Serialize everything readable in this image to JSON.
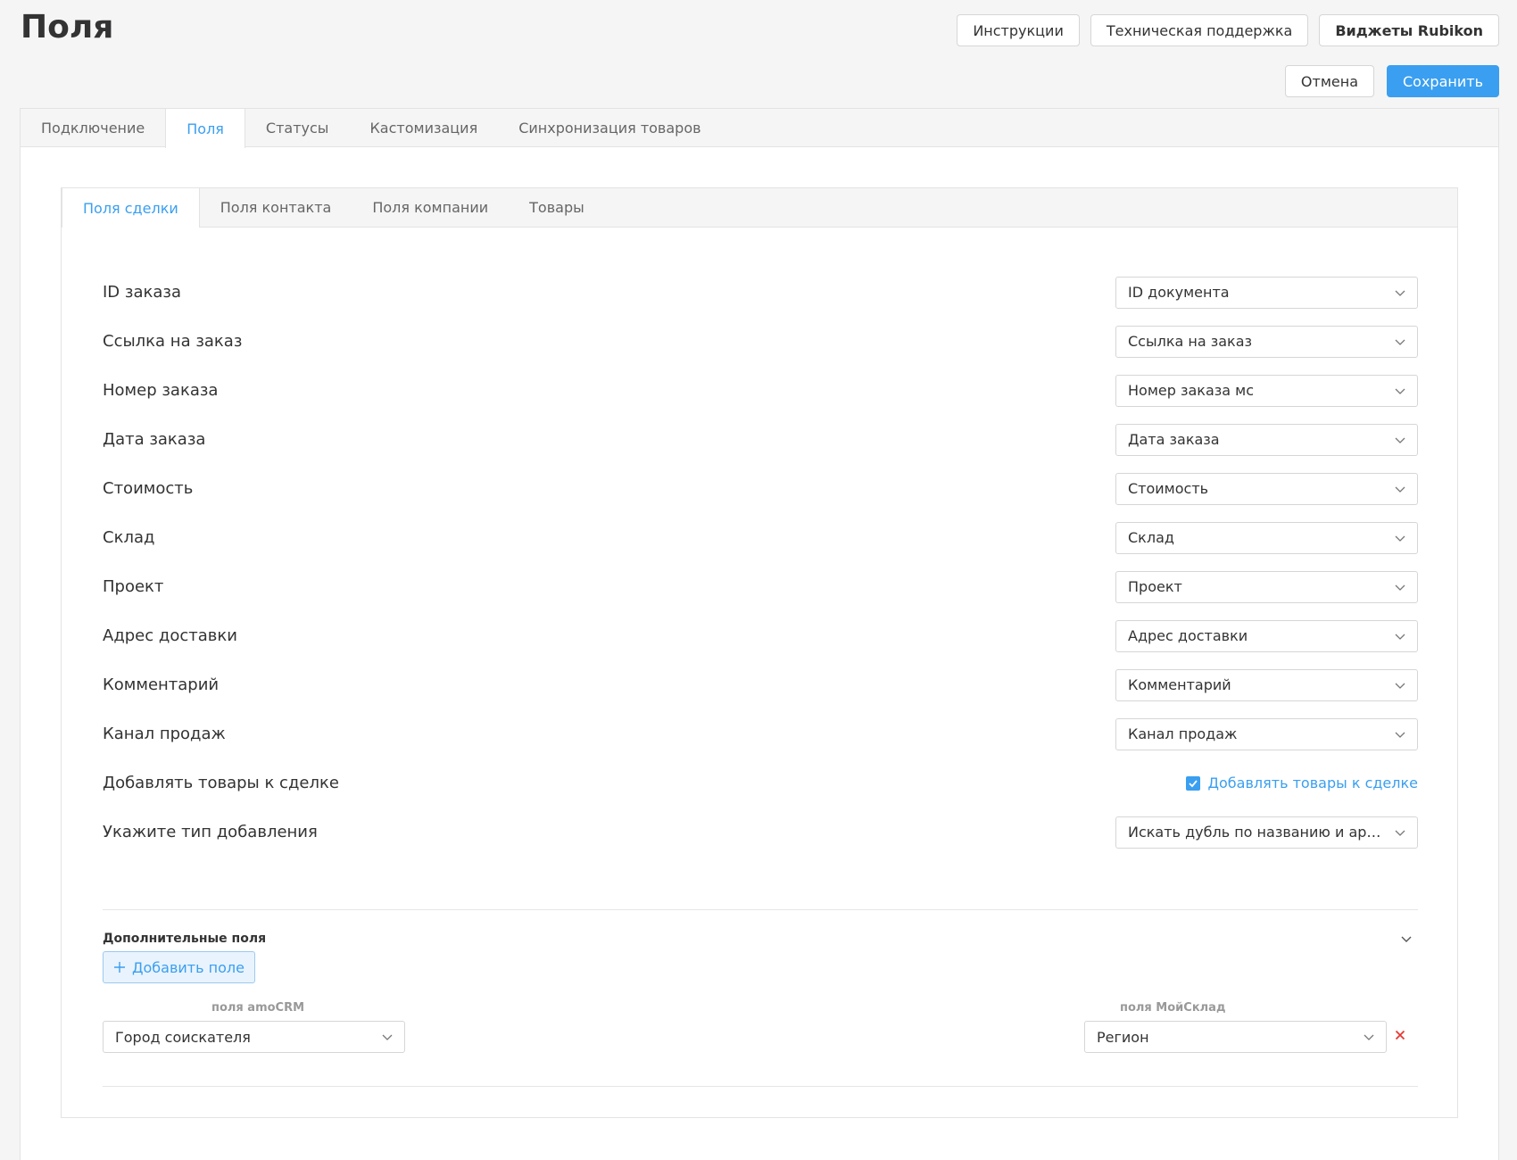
{
  "header": {
    "title": "Поля",
    "instructions_label": "Инструкции",
    "support_label": "Техническая поддержка",
    "widgets_label": "Виджеты Rubikon",
    "cancel_label": "Отмена",
    "save_label": "Сохранить"
  },
  "main_tabs": [
    {
      "label": "Подключение",
      "active": false
    },
    {
      "label": "Поля",
      "active": true
    },
    {
      "label": "Статусы",
      "active": false
    },
    {
      "label": "Кастомизация",
      "active": false
    },
    {
      "label": "Синхронизация товаров",
      "active": false
    }
  ],
  "sub_tabs": [
    {
      "label": "Поля сделки",
      "active": true
    },
    {
      "label": "Поля контакта",
      "active": false
    },
    {
      "label": "Поля компании",
      "active": false
    },
    {
      "label": "Товары",
      "active": false
    }
  ],
  "fields": [
    {
      "label": "ID заказа",
      "value": "ID документа"
    },
    {
      "label": "Ссылка на заказ",
      "value": "Ссылка на заказ"
    },
    {
      "label": "Номер заказа",
      "value": "Номер заказа мс"
    },
    {
      "label": "Дата заказа",
      "value": "Дата заказа"
    },
    {
      "label": "Стоимость",
      "value": "Стоимость"
    },
    {
      "label": "Склад",
      "value": "Склад"
    },
    {
      "label": "Проект",
      "value": "Проект"
    },
    {
      "label": "Адрес доставки",
      "value": "Адрес доставки"
    },
    {
      "label": "Комментарий",
      "value": "Комментарий"
    },
    {
      "label": "Канал продаж",
      "value": "Канал продаж"
    }
  ],
  "add_products": {
    "label": "Добавлять товары к сделке",
    "checkbox_label": "Добавлять товары к сделке",
    "checked": true
  },
  "add_type": {
    "label": "Укажите тип добавления",
    "value": "Искать дубль по названию и артикулу"
  },
  "extra": {
    "title": "Дополнительные поля",
    "add_button_label": "Добавить поле",
    "amo_header": "поля amoCRM",
    "ms_header": "поля МойСклад",
    "mappings": [
      {
        "amo": "Город соискателя",
        "ms": "Регион"
      }
    ]
  },
  "colors": {
    "accent": "#3a9ff0",
    "remove": "#e53935"
  }
}
